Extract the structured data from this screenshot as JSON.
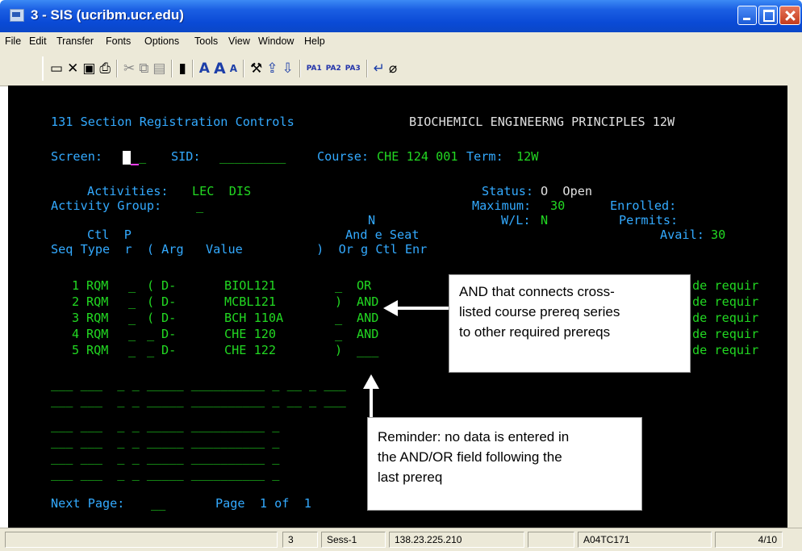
{
  "window": {
    "title": "3 - SIS (ucribm.ucr.edu)"
  },
  "menu": [
    "File",
    "Edit",
    "Transfer",
    "Fonts",
    "Options",
    "Tools",
    "View",
    "Window",
    "Help"
  ],
  "toolbar": {
    "pa1": "PA1",
    "pa2": "PA2",
    "pa3": "PA3"
  },
  "terminal": {
    "screen_title": "131 Section Registration Controls",
    "course_title": "BIOCHEMICL ENGINEERNG PRINCIPLES 12W",
    "screen_label": "Screen:",
    "sid_label": "SID:",
    "course_label": "Course:",
    "course_value": "CHE 124 001",
    "term_label": "Term:",
    "term_value": "12W",
    "activities_label": "Activities:",
    "activities_value": "LEC  DIS",
    "activity_group_label": "Activity Group:",
    "status_label": "Status:",
    "status_value": "O  Open",
    "maximum_label": "Maximum:",
    "maximum_value": "30",
    "enrolled_label": "Enrolled:",
    "wl_label": "W/L:",
    "wl_value": "N",
    "permits_label": "Permits:",
    "avail_label": "Avail:",
    "avail_value": "30",
    "hdr_n": "N",
    "hdr_row1": "Ctl  P                             And e Seat",
    "hdr_row2": "Seq Type  r  ( Arg   Value          )  Or g Ctl Enr",
    "rows": [
      {
        "seq": "1",
        "type": "RQM",
        "r": "_",
        "paren": "(",
        "arg": "D-",
        "value": "BIOL121",
        "close": "_",
        "andor": "OR",
        "tail": "de requir"
      },
      {
        "seq": "2",
        "type": "RQM",
        "r": "_",
        "paren": "(",
        "arg": "D-",
        "value": "MCBL121",
        "close": ")",
        "andor": "AND",
        "tail": "de requir"
      },
      {
        "seq": "3",
        "type": "RQM",
        "r": "_",
        "paren": "(",
        "arg": "D-",
        "value": "BCH 110A",
        "close": "_",
        "andor": "AND",
        "tail": "de requir"
      },
      {
        "seq": "4",
        "type": "RQM",
        "r": "_",
        "paren": "_",
        "arg": "D-",
        "value": "CHE 120",
        "close": "_",
        "andor": "AND",
        "tail": "de requir"
      },
      {
        "seq": "5",
        "type": "RQM",
        "r": "_",
        "paren": "_",
        "arg": "D-",
        "value": "CHE 122",
        "close": ")",
        "andor": "___",
        "tail": "de requir"
      }
    ],
    "next_page_label": "Next Page:",
    "page_label": "Page  1 of  1"
  },
  "callouts": {
    "and": "AND that connects cross-\nlisted course prereq series\nto other required prereqs",
    "reminder": "Reminder: no  data is entered in\nthe AND/OR field following the\nlast prereq"
  },
  "statusbar": {
    "cell1": "3",
    "cell2": "Sess-1",
    "cell3": "138.23.225.210",
    "cell4": "A04TC171",
    "cell5": "4/10"
  }
}
